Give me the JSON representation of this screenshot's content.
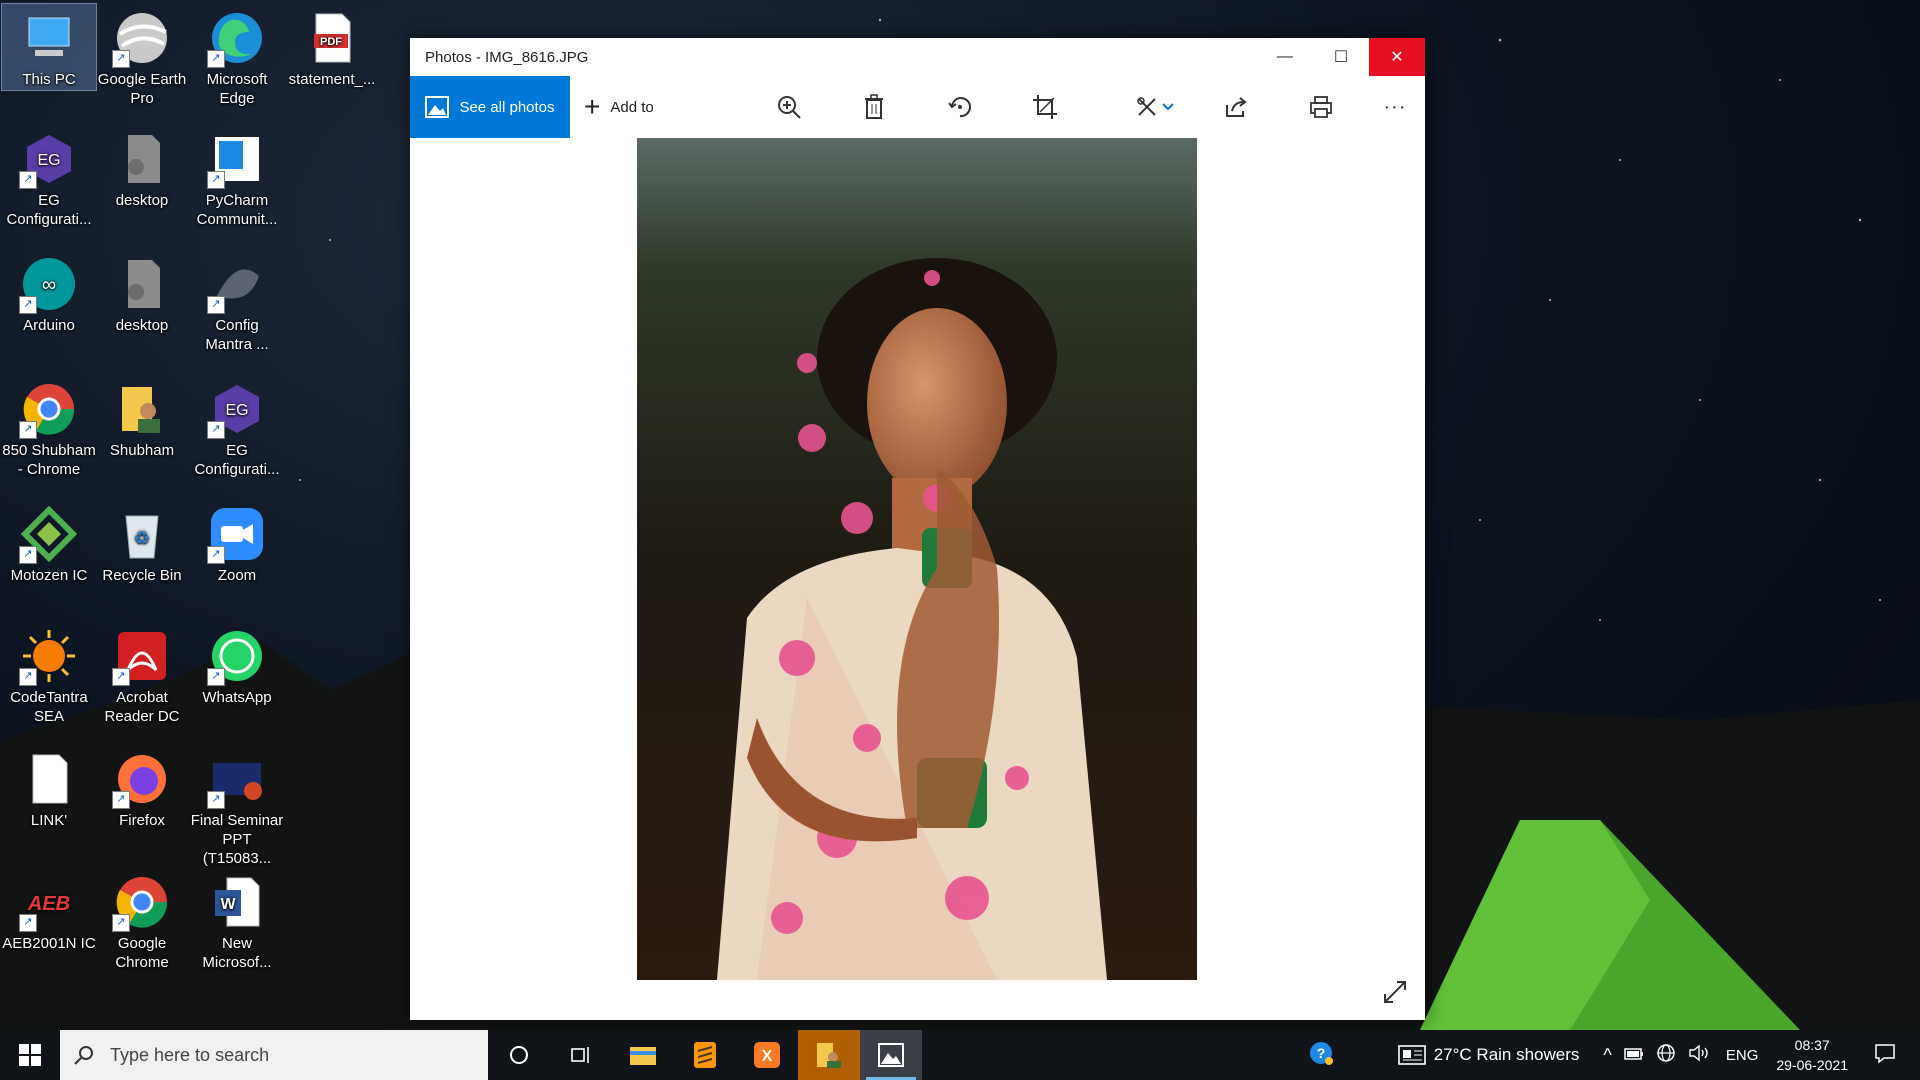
{
  "desktop": {
    "icons": [
      {
        "label": "This PC",
        "icon": "computer-icon"
      },
      {
        "label": "Google Earth Pro",
        "icon": "google-earth-icon"
      },
      {
        "label": "Microsoft Edge",
        "icon": "edge-icon"
      },
      {
        "label": "statement_...",
        "icon": "pdf-file-icon"
      },
      {
        "label": "EG Configurati...",
        "icon": "eg-icon"
      },
      {
        "label": "desktop",
        "icon": "desktop-ini-icon"
      },
      {
        "label": "PyCharm Communit...",
        "icon": "pycharm-icon"
      },
      {
        "label": "Arduino",
        "icon": "arduino-icon"
      },
      {
        "label": "desktop",
        "icon": "desktop-ini-icon"
      },
      {
        "label": "Config Mantra ...",
        "icon": "config-mantra-icon"
      },
      {
        "label": "850 Shubham - Chrome",
        "icon": "chrome-profile-icon"
      },
      {
        "label": "Shubham",
        "icon": "user-folder-icon"
      },
      {
        "label": "EG Configurati...",
        "icon": "eg-icon"
      },
      {
        "label": "Motozen IC",
        "icon": "motozen-icon"
      },
      {
        "label": "Recycle Bin",
        "icon": "recycle-bin-icon"
      },
      {
        "label": "Zoom",
        "icon": "zoom-icon"
      },
      {
        "label": "CodeTantra SEA",
        "icon": "codetantra-icon"
      },
      {
        "label": "Acrobat Reader DC",
        "icon": "acrobat-icon"
      },
      {
        "label": "WhatsApp",
        "icon": "whatsapp-icon"
      },
      {
        "label": "LINK'",
        "icon": "text-file-icon"
      },
      {
        "label": "Firefox",
        "icon": "firefox-icon"
      },
      {
        "label": "Final Seminar PPT (T15083...",
        "icon": "powerpoint-file-icon"
      },
      {
        "label": "AEB2001N IC",
        "icon": "aeb-icon"
      },
      {
        "label": "Google Chrome",
        "icon": "chrome-icon"
      },
      {
        "label": "New Microsof...",
        "icon": "word-icon"
      }
    ]
  },
  "window": {
    "title": "Photos - IMG_8616.JPG",
    "toolbar": {
      "see_all": "See all photos",
      "add_to": "Add to"
    }
  },
  "taskbar": {
    "search_placeholder": "Type here to search",
    "weather": "27°C  Rain showers",
    "language": "ENG",
    "time": "08:37",
    "date": "29-06-2021"
  },
  "colors": {
    "accent": "#0078d7",
    "close": "#e81123",
    "taskbar": "#101418"
  }
}
